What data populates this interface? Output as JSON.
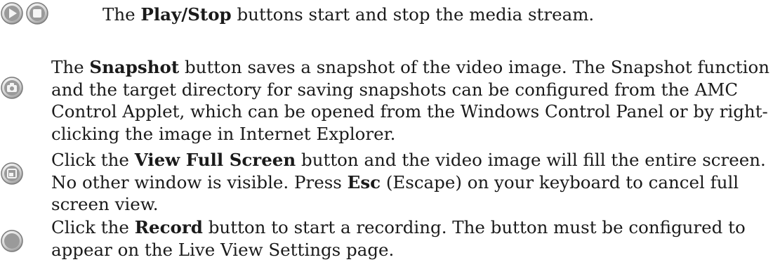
{
  "items": [
    {
      "icons": [
        "play-icon",
        "stop-icon"
      ],
      "bold": "Play/Stop",
      "before": "The ",
      "after": " buttons start and stop the media stream."
    },
    {
      "icons": [
        "snapshot-icon"
      ],
      "bold": "Snapshot",
      "before": "The ",
      "after": " button saves a snapshot of the video image. The Snapshot function and the target directory for saving snapshots can be configured from the AMC Control Applet, which can be opened from the Windows Control Panel or by right-clicking the image in Internet Explorer."
    },
    {
      "icons": [
        "fullscreen-icon"
      ],
      "before": "Click the ",
      "bold": "View Full Screen",
      "after": " button and the video image will fill the entire screen. No other window is visible. Press ",
      "bold2": "Esc",
      "after2": " (Escape) on your keyboard to cancel full screen view."
    },
    {
      "icons": [
        "record-icon"
      ],
      "before": "Click the ",
      "bold": "Record",
      "after": " button to start a recording. The button must be configured to appear on the Live View Settings page."
    }
  ],
  "colors": {
    "icon_fill_light": "#f2f2f2",
    "icon_fill_dark": "#b8b8b8",
    "icon_stroke": "#8a8a8a",
    "text": "#1a1a1a"
  }
}
